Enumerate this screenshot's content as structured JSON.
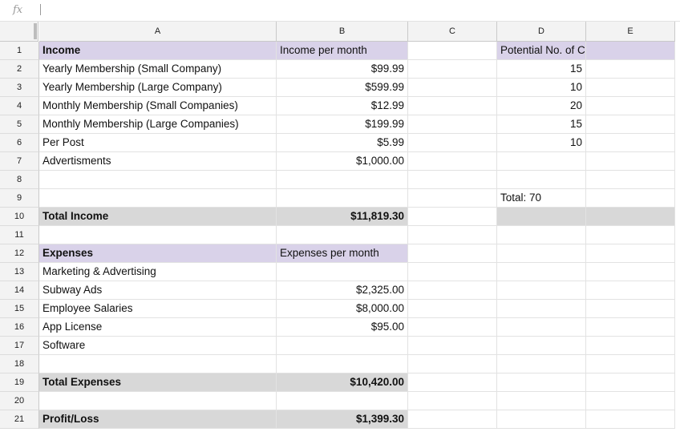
{
  "formula_bar": {
    "fx_label": "fx",
    "value": ""
  },
  "columns": [
    "A",
    "B",
    "C",
    "D",
    "E"
  ],
  "rows": [
    {
      "n": "1",
      "a": "Income",
      "b": "Income per month",
      "c": "",
      "d": "Potential No. of Customers",
      "e": ""
    },
    {
      "n": "2",
      "a": "Yearly Membership (Small Company)",
      "b": "$99.99",
      "c": "",
      "d": "15",
      "e": ""
    },
    {
      "n": "3",
      "a": "Yearly Membership (Large Company)",
      "b": "$599.99",
      "c": "",
      "d": "10",
      "e": ""
    },
    {
      "n": "4",
      "a": "Monthly Membership (Small Companies)",
      "b": "$12.99",
      "c": "",
      "d": "20",
      "e": ""
    },
    {
      "n": "5",
      "a": "Monthly Membership (Large Companies)",
      "b": "$199.99",
      "c": "",
      "d": "15",
      "e": ""
    },
    {
      "n": "6",
      "a": "Per Post",
      "b": "$5.99",
      "c": "",
      "d": "10",
      "e": ""
    },
    {
      "n": "7",
      "a": "Advertisments",
      "b": "$1,000.00",
      "c": "",
      "d": "",
      "e": ""
    },
    {
      "n": "8",
      "a": "",
      "b": "",
      "c": "",
      "d": "",
      "e": ""
    },
    {
      "n": "9",
      "a": "",
      "b": "",
      "c": "",
      "d": "Total: 70",
      "e": ""
    },
    {
      "n": "10",
      "a": "Total Income",
      "b": "$11,819.30",
      "c": "",
      "d": "",
      "e": ""
    },
    {
      "n": "11",
      "a": "",
      "b": "",
      "c": "",
      "d": "",
      "e": ""
    },
    {
      "n": "12",
      "a": "Expenses",
      "b": "Expenses per month",
      "c": "",
      "d": "",
      "e": ""
    },
    {
      "n": "13",
      "a": "Marketing & Advertising",
      "b": "",
      "c": "",
      "d": "",
      "e": ""
    },
    {
      "n": "14",
      "a": "Subway Ads",
      "b": "$2,325.00",
      "c": "",
      "d": "",
      "e": ""
    },
    {
      "n": "15",
      "a": "Employee Salaries",
      "b": "$8,000.00",
      "c": "",
      "d": "",
      "e": ""
    },
    {
      "n": "16",
      "a": "App License",
      "b": "$95.00",
      "c": "",
      "d": "",
      "e": ""
    },
    {
      "n": "17",
      "a": "Software",
      "b": "",
      "c": "",
      "d": "",
      "e": ""
    },
    {
      "n": "18",
      "a": "",
      "b": "",
      "c": "",
      "d": "",
      "e": ""
    },
    {
      "n": "19",
      "a": "Total Expenses",
      "b": "$10,420.00",
      "c": "",
      "d": "",
      "e": ""
    },
    {
      "n": "20",
      "a": "",
      "b": "",
      "c": "",
      "d": "",
      "e": ""
    },
    {
      "n": "21",
      "a": "Profit/Loss",
      "b": "$1,399.30",
      "c": "",
      "d": "",
      "e": ""
    }
  ],
  "colors": {
    "header_fill": "#d9d2e9",
    "total_fill": "#d8d8d8",
    "gridline": "#e2e2e2",
    "heading_bg": "#f3f3f3"
  }
}
